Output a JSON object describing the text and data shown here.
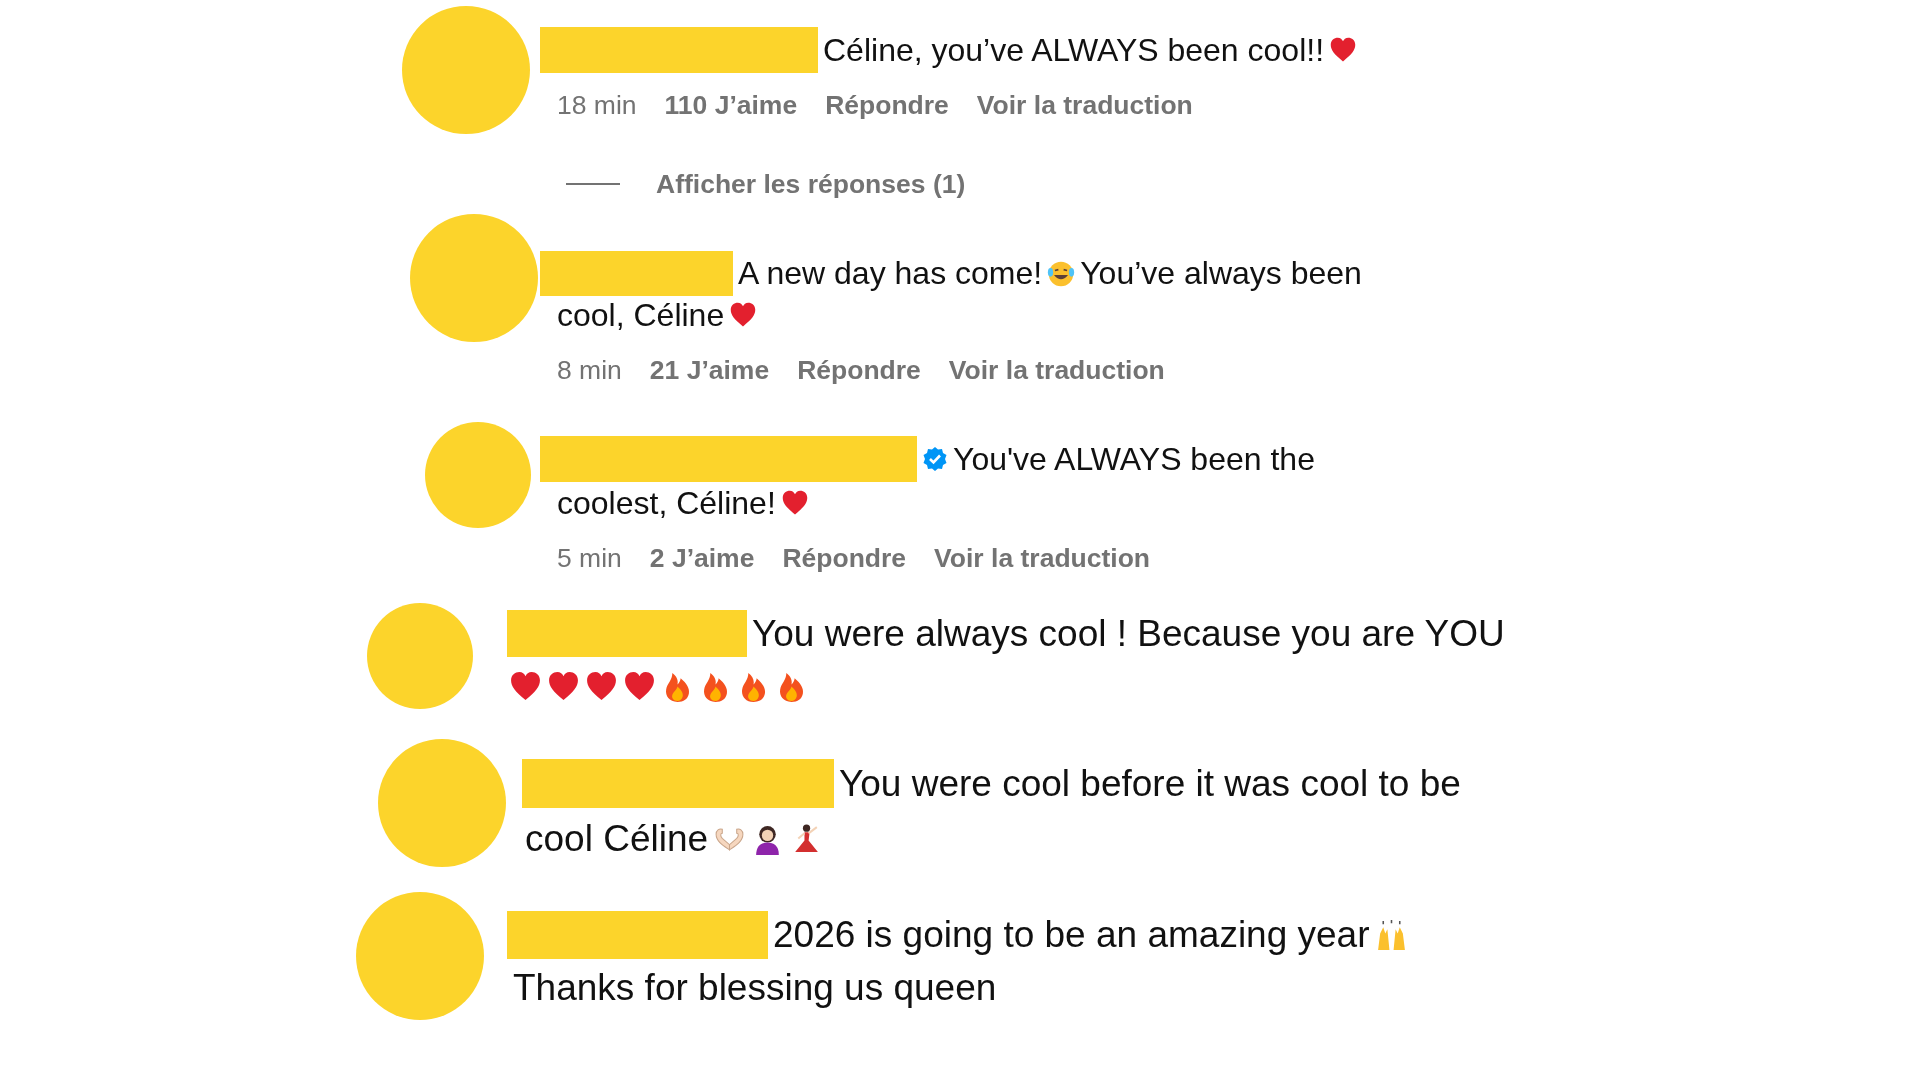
{
  "comments": [
    {
      "verified": false,
      "lines": [
        [
          {
            "kind": "text",
            "text": "Céline, you’ve ALWAYS been cool!!"
          },
          {
            "kind": "heart"
          }
        ]
      ],
      "meta": {
        "time": "18 min",
        "likes": "110 J’aime",
        "reply": "Répondre",
        "translate": "Voir la traduction"
      },
      "replies": "Afficher les réponses (1)"
    },
    {
      "verified": false,
      "lines": [
        [
          {
            "kind": "text",
            "text": "A new day has come!"
          },
          {
            "kind": "laugh"
          },
          {
            "kind": "text",
            "text": "You’ve always been"
          }
        ],
        [
          {
            "kind": "text",
            "text": "cool, Céline"
          },
          {
            "kind": "heart"
          }
        ]
      ],
      "meta": {
        "time": "8 min",
        "likes": "21 J’aime",
        "reply": "Répondre",
        "translate": "Voir la traduction"
      }
    },
    {
      "verified": true,
      "lines": [
        [
          {
            "kind": "text",
            "text": "You've ALWAYS been the"
          }
        ],
        [
          {
            "kind": "text",
            "text": "coolest, Céline!"
          },
          {
            "kind": "heart"
          }
        ]
      ],
      "meta": {
        "time": "5 min",
        "likes": "2 J’aime",
        "reply": "Répondre",
        "translate": "Voir la traduction"
      }
    },
    {
      "verified": false,
      "lines": [
        [
          {
            "kind": "text",
            "text": "You were always cool ! Because you are YOU"
          }
        ],
        [
          {
            "kind": "heart"
          },
          {
            "kind": "heart"
          },
          {
            "kind": "heart"
          },
          {
            "kind": "heart"
          },
          {
            "kind": "fire"
          },
          {
            "kind": "fire"
          },
          {
            "kind": "fire"
          },
          {
            "kind": "fire"
          }
        ]
      ]
    },
    {
      "verified": false,
      "lines": [
        [
          {
            "kind": "text",
            "text": "You were cool before it was cool to be"
          }
        ],
        [
          {
            "kind": "text",
            "text": "cool Céline"
          },
          {
            "kind": "hands-heart"
          },
          {
            "kind": "person"
          },
          {
            "kind": "dancer"
          }
        ]
      ]
    },
    {
      "verified": false,
      "lines": [
        [
          {
            "kind": "text",
            "text": "2026 is going to be an amazing year"
          },
          {
            "kind": "raised-hands"
          }
        ],
        [
          {
            "kind": "text",
            "text": "Thanks for blessing us queen"
          }
        ]
      ]
    }
  ]
}
